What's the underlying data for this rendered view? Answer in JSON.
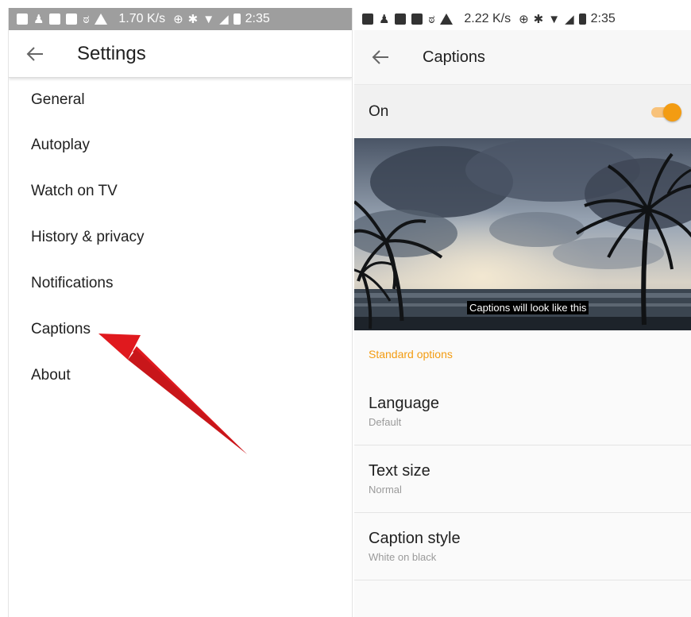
{
  "left": {
    "status_bar": {
      "speed": "1.70 K/s",
      "time": "2:35"
    },
    "app_bar": {
      "title": "Settings"
    },
    "items": [
      {
        "label": "General"
      },
      {
        "label": "Autoplay"
      },
      {
        "label": "Watch on TV"
      },
      {
        "label": "History & privacy"
      },
      {
        "label": "Notifications"
      },
      {
        "label": "Captions"
      },
      {
        "label": "About"
      }
    ]
  },
  "right": {
    "status_bar": {
      "speed": "2.22 K/s",
      "time": "2:35"
    },
    "app_bar": {
      "title": "Captions"
    },
    "toggle": {
      "label": "On",
      "state": "on"
    },
    "preview": {
      "caption_text": "Captions will look like this"
    },
    "section_header": "Standard options",
    "options": [
      {
        "title": "Language",
        "value": "Default"
      },
      {
        "title": "Text size",
        "value": "Normal"
      },
      {
        "title": "Caption style",
        "value": "White on black"
      }
    ]
  },
  "icons": {
    "back": "arrow-left-icon",
    "annotation": "red-arrow-annotation"
  },
  "colors": {
    "accent": "#f39c12",
    "accent_track": "#f8c27a",
    "annotation_red": "#e0191e",
    "left_status_bar": "#9e9e9e",
    "text_primary": "#212121",
    "text_secondary": "#9a9a9a"
  }
}
